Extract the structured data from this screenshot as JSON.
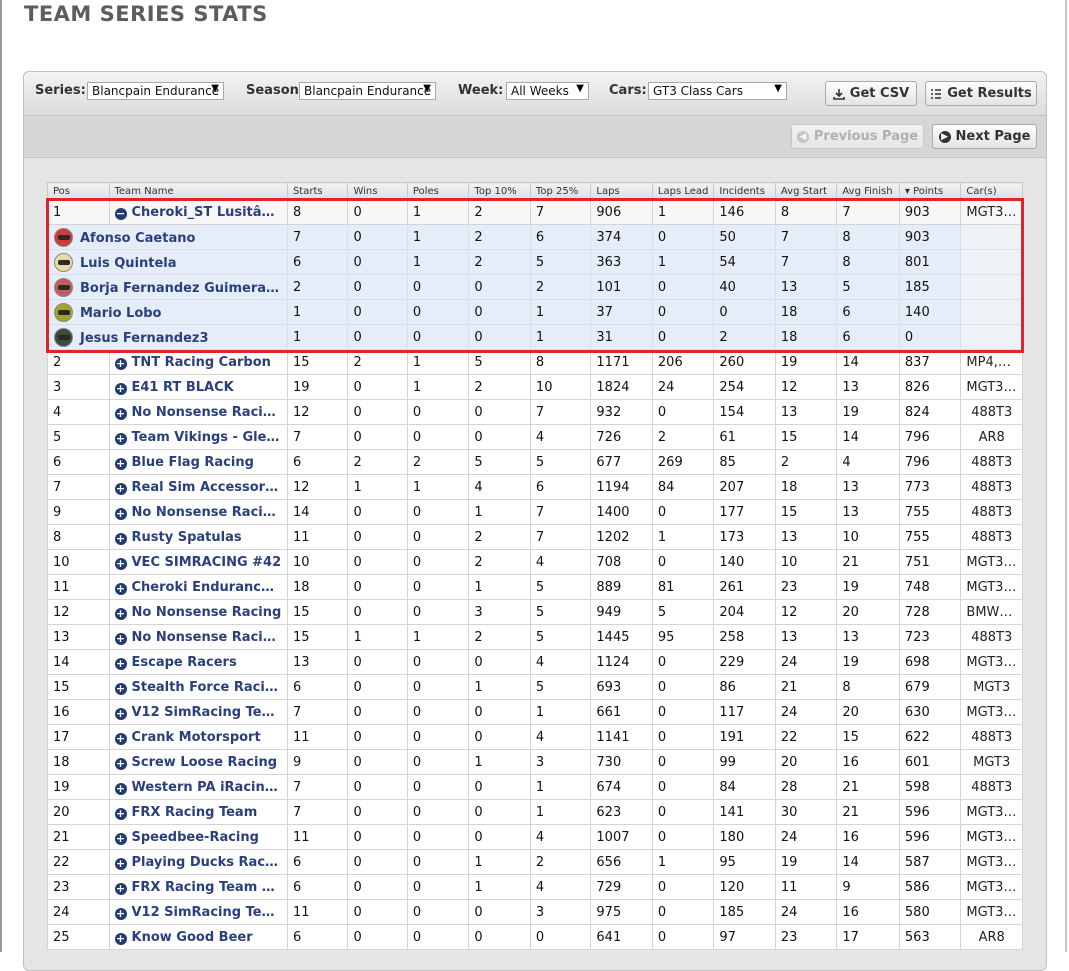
{
  "page": {
    "title": "TEAM SERIES STATS"
  },
  "filters": {
    "series_label": "Series:",
    "series_value": "Blancpain Endurance",
    "season_label": "Season",
    "season_value": "Blancpain Endurance",
    "week_label": "Week:",
    "week_value": "All Weeks",
    "cars_label": "Cars:",
    "cars_value": "GT3 Class Cars",
    "get_csv": "Get CSV",
    "get_results": "Get Results"
  },
  "pager": {
    "previous": "Previous Page",
    "next": "Next Page"
  },
  "table": {
    "columns": [
      "Pos",
      "Team Name",
      "Starts",
      "Wins",
      "Poles",
      "Top 10%",
      "Top 25%",
      "Laps",
      "Laps Lead",
      "Incidents",
      "Avg Start",
      "Avg Finish",
      "Points",
      "Car(s)"
    ],
    "sort_icon": "sort-desc-icon",
    "expanded_team": {
      "pos": "1",
      "name": "Cheroki_ST Lusitânia",
      "icon": "minus-circle-icon",
      "cells": [
        "8",
        "0",
        "1",
        "2",
        "7",
        "906",
        "1",
        "146",
        "8",
        "7",
        "903"
      ],
      "cars": "MGT3,..."
    },
    "drivers": [
      {
        "name": "Afonso Caetano",
        "helmet_color": "#d23a3a",
        "cells": [
          "7",
          "0",
          "1",
          "2",
          "6",
          "374",
          "0",
          "50",
          "7",
          "8",
          "903"
        ]
      },
      {
        "name": "Luis Quintela",
        "helmet_color": "#e9d9a5",
        "cells": [
          "6",
          "0",
          "1",
          "2",
          "5",
          "363",
          "1",
          "54",
          "7",
          "8",
          "801"
        ]
      },
      {
        "name": "Borja Fernandez Guimerans2",
        "helmet_color": "#c75c5c",
        "cells": [
          "2",
          "0",
          "0",
          "0",
          "2",
          "101",
          "0",
          "40",
          "13",
          "5",
          "185"
        ]
      },
      {
        "name": "Mario Lobo",
        "helmet_color": "#a3a32a",
        "cells": [
          "1",
          "0",
          "0",
          "0",
          "1",
          "37",
          "0",
          "0",
          "18",
          "6",
          "140"
        ]
      },
      {
        "name": "Jesus Fernandez3",
        "helmet_color": "#3f4a3a",
        "cells": [
          "1",
          "0",
          "0",
          "0",
          "1",
          "31",
          "0",
          "2",
          "18",
          "6",
          "0"
        ]
      }
    ],
    "teams": [
      {
        "pos": "2",
        "name": "TNT Racing Carbon",
        "cells": [
          "15",
          "2",
          "1",
          "5",
          "8",
          "1171",
          "206",
          "260",
          "19",
          "14",
          "837"
        ],
        "cars": "MP4,M..."
      },
      {
        "pos": "3",
        "name": "E41 RT BLACK",
        "cells": [
          "19",
          "0",
          "1",
          "2",
          "10",
          "1824",
          "24",
          "254",
          "12",
          "13",
          "826"
        ],
        "cars": "MGT3,..."
      },
      {
        "pos": "4",
        "name": "No Nonsense Racing...",
        "cells": [
          "12",
          "0",
          "0",
          "0",
          "7",
          "932",
          "0",
          "154",
          "13",
          "19",
          "824"
        ],
        "cars": "488T3"
      },
      {
        "pos": "5",
        "name": "Team Vikings - Gleip...",
        "cells": [
          "7",
          "0",
          "0",
          "0",
          "4",
          "726",
          "2",
          "61",
          "15",
          "14",
          "796"
        ],
        "cars": "AR8"
      },
      {
        "pos": "6",
        "name": "Blue Flag Racing",
        "cells": [
          "6",
          "2",
          "2",
          "5",
          "5",
          "677",
          "269",
          "85",
          "2",
          "4",
          "796"
        ],
        "cars": "488T3"
      },
      {
        "pos": "7",
        "name": "Real Sim Accessorie...",
        "cells": [
          "12",
          "1",
          "1",
          "4",
          "6",
          "1194",
          "84",
          "207",
          "18",
          "13",
          "773"
        ],
        "cars": "488T3"
      },
      {
        "pos": "9",
        "name": "No Nonsense Racing...",
        "cells": [
          "14",
          "0",
          "0",
          "1",
          "7",
          "1400",
          "0",
          "177",
          "15",
          "13",
          "755"
        ],
        "cars": "488T3"
      },
      {
        "pos": "8",
        "name": "Rusty Spatulas",
        "cells": [
          "11",
          "0",
          "0",
          "2",
          "7",
          "1202",
          "1",
          "173",
          "13",
          "10",
          "755"
        ],
        "cars": "488T3"
      },
      {
        "pos": "10",
        "name": "VEC SIMRACING #42",
        "cells": [
          "10",
          "0",
          "0",
          "2",
          "4",
          "708",
          "0",
          "140",
          "10",
          "21",
          "751"
        ],
        "cars": "MGT3,..."
      },
      {
        "pos": "11",
        "name": "Cheroki Endurance T...",
        "cells": [
          "18",
          "0",
          "0",
          "1",
          "5",
          "889",
          "81",
          "261",
          "23",
          "19",
          "748"
        ],
        "cars": "MGT3,..."
      },
      {
        "pos": "12",
        "name": "No Nonsense Racing",
        "cells": [
          "15",
          "0",
          "0",
          "3",
          "5",
          "949",
          "5",
          "204",
          "12",
          "20",
          "728"
        ],
        "cars": "BMWZ..."
      },
      {
        "pos": "13",
        "name": "No Nonsense Racing...",
        "cells": [
          "15",
          "1",
          "1",
          "2",
          "5",
          "1445",
          "95",
          "258",
          "13",
          "13",
          "723"
        ],
        "cars": "488T3"
      },
      {
        "pos": "14",
        "name": "Escape Racers",
        "cells": [
          "13",
          "0",
          "0",
          "0",
          "4",
          "1124",
          "0",
          "229",
          "24",
          "19",
          "698"
        ],
        "cars": "MGT3,..."
      },
      {
        "pos": "15",
        "name": "Stealth Force Racing",
        "cells": [
          "6",
          "0",
          "0",
          "1",
          "5",
          "693",
          "0",
          "86",
          "21",
          "8",
          "679"
        ],
        "cars": "MGT3"
      },
      {
        "pos": "16",
        "name": "V12 SimRacing Tea...",
        "cells": [
          "7",
          "0",
          "0",
          "0",
          "1",
          "661",
          "0",
          "117",
          "24",
          "20",
          "630"
        ],
        "cars": "MGT3,..."
      },
      {
        "pos": "17",
        "name": "Crank Motorsport",
        "cells": [
          "11",
          "0",
          "0",
          "0",
          "4",
          "1141",
          "0",
          "191",
          "22",
          "15",
          "622"
        ],
        "cars": "488T3"
      },
      {
        "pos": "18",
        "name": "Screw Loose Racing",
        "cells": [
          "9",
          "0",
          "0",
          "1",
          "3",
          "730",
          "0",
          "99",
          "20",
          "16",
          "601"
        ],
        "cars": "MGT3"
      },
      {
        "pos": "19",
        "name": "Western PA iRacing ...",
        "cells": [
          "7",
          "0",
          "0",
          "0",
          "1",
          "674",
          "0",
          "84",
          "28",
          "21",
          "598"
        ],
        "cars": "488T3"
      },
      {
        "pos": "20",
        "name": "FRX Racing Team",
        "cells": [
          "7",
          "0",
          "0",
          "0",
          "1",
          "623",
          "0",
          "141",
          "30",
          "21",
          "596"
        ],
        "cars": "MGT3,..."
      },
      {
        "pos": "21",
        "name": "Speedbee-Racing",
        "cells": [
          "11",
          "0",
          "0",
          "0",
          "4",
          "1007",
          "0",
          "180",
          "24",
          "16",
          "596"
        ],
        "cars": "MGT3,..."
      },
      {
        "pos": "22",
        "name": "Playing Ducks Racin...",
        "cells": [
          "6",
          "0",
          "0",
          "1",
          "2",
          "656",
          "1",
          "95",
          "19",
          "14",
          "587"
        ],
        "cars": "MGT3,..."
      },
      {
        "pos": "23",
        "name": "FRX Racing Team Or...",
        "cells": [
          "6",
          "0",
          "0",
          "1",
          "4",
          "729",
          "0",
          "120",
          "11",
          "9",
          "586"
        ],
        "cars": "MGT3,..."
      },
      {
        "pos": "24",
        "name": "V12 SimRacing Tea...",
        "cells": [
          "11",
          "0",
          "0",
          "0",
          "3",
          "975",
          "0",
          "185",
          "24",
          "16",
          "580"
        ],
        "cars": "MGT3,..."
      },
      {
        "pos": "25",
        "name": "Know Good Beer",
        "cells": [
          "6",
          "0",
          "0",
          "0",
          "0",
          "641",
          "0",
          "97",
          "23",
          "17",
          "563"
        ],
        "cars": "AR8"
      }
    ]
  },
  "colors": {
    "team_link": "#2a3f7d",
    "highlight_border": "#e0242c",
    "driver_row_bg": "#e5eef8"
  }
}
